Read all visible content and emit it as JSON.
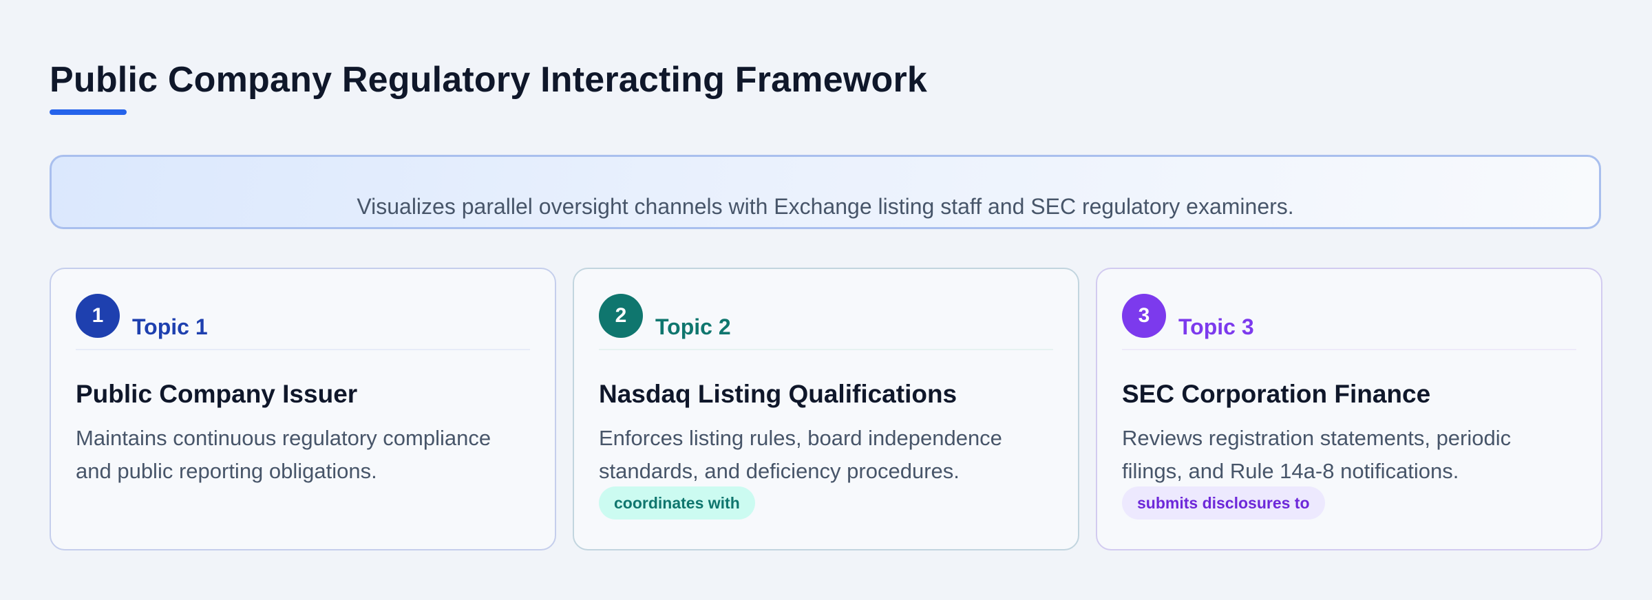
{
  "header": {
    "title": "Public Company Regulatory Interacting Framework"
  },
  "summary": {
    "text": "Visualizes parallel oversight channels with Exchange listing staff and SEC regulatory examiners."
  },
  "colors": {
    "accent": "#2563eb",
    "topic_1": "#1e40af",
    "topic_2": "#0f766e",
    "topic_3": "#7c3aed"
  },
  "cards": [
    {
      "number": "1",
      "topic": "Topic 1",
      "title": "Public Company Issuer",
      "description": "Maintains continuous regulatory compliance and public reporting obligations."
    },
    {
      "number": "2",
      "topic": "Topic 2",
      "title": "Nasdaq Listing Qualifications",
      "description": "Enforces listing rules, board independence standards, and deficiency procedures.",
      "relation": "coordinates with"
    },
    {
      "number": "3",
      "topic": "Topic 3",
      "title": "SEC Corporation Finance",
      "description": "Reviews registration statements, periodic filings, and Rule 14a-8 notifications.",
      "relation": "submits disclosures to"
    }
  ]
}
